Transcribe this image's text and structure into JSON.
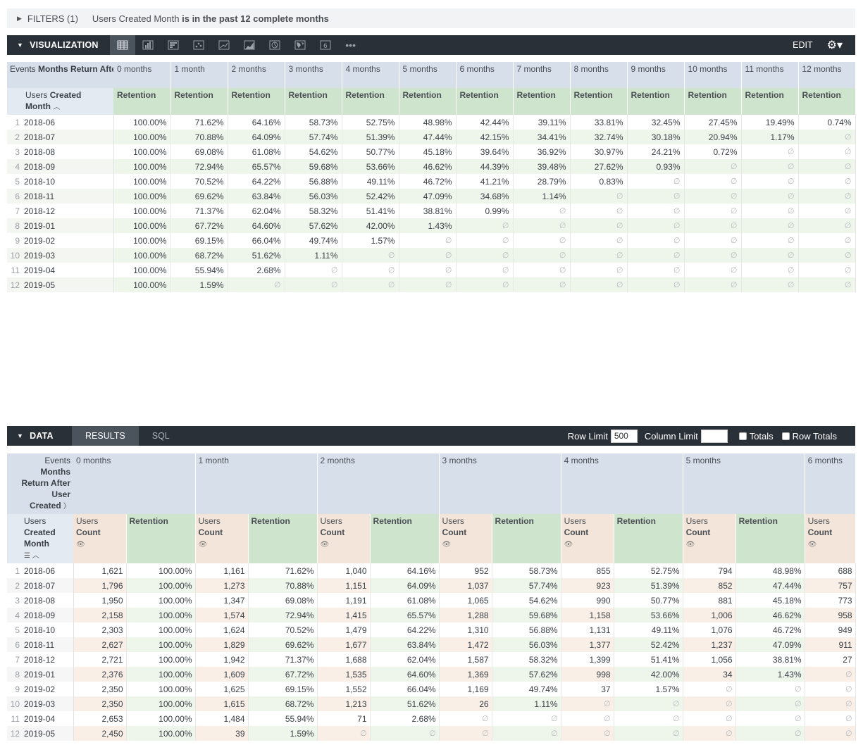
{
  "filters": {
    "label": "FILTERS (1)",
    "field": "Users Created Month",
    "condition": "is in the past 12 complete months"
  },
  "visualization": {
    "title": "VISUALIZATION",
    "edit_label": "EDIT",
    "icons": [
      "table-icon",
      "bar-chart-icon",
      "column-chart-icon",
      "scatter-icon",
      "line-icon",
      "area-icon",
      "pie-icon",
      "map-icon",
      "single-value-icon",
      "more-icon"
    ]
  },
  "viz_table": {
    "pivot_label_1": "Events",
    "pivot_label_bold": "Months Return After User Created",
    "dim_label_1": "Users",
    "dim_label_bold": "Created",
    "dim_label_2": "Month",
    "measure": "Retention",
    "columns": [
      "0 months",
      "1 month",
      "2 months",
      "3 months",
      "4 months",
      "5 months",
      "6 months",
      "7 months",
      "8 months",
      "9 months",
      "10 months",
      "11 months",
      "12 months"
    ],
    "rows": [
      {
        "n": "1",
        "month": "2018-06",
        "v": [
          "100.00%",
          "71.62%",
          "64.16%",
          "58.73%",
          "52.75%",
          "48.98%",
          "42.44%",
          "39.11%",
          "33.81%",
          "32.45%",
          "27.45%",
          "19.49%",
          "0.74%"
        ]
      },
      {
        "n": "2",
        "month": "2018-07",
        "v": [
          "100.00%",
          "70.88%",
          "64.09%",
          "57.74%",
          "51.39%",
          "47.44%",
          "42.15%",
          "34.41%",
          "32.74%",
          "30.18%",
          "20.94%",
          "1.17%",
          "∅"
        ]
      },
      {
        "n": "3",
        "month": "2018-08",
        "v": [
          "100.00%",
          "69.08%",
          "61.08%",
          "54.62%",
          "50.77%",
          "45.18%",
          "39.64%",
          "36.92%",
          "30.97%",
          "24.21%",
          "0.72%",
          "∅",
          "∅"
        ]
      },
      {
        "n": "4",
        "month": "2018-09",
        "v": [
          "100.00%",
          "72.94%",
          "65.57%",
          "59.68%",
          "53.66%",
          "46.62%",
          "44.39%",
          "39.48%",
          "27.62%",
          "0.93%",
          "∅",
          "∅",
          "∅"
        ]
      },
      {
        "n": "5",
        "month": "2018-10",
        "v": [
          "100.00%",
          "70.52%",
          "64.22%",
          "56.88%",
          "49.11%",
          "46.72%",
          "41.21%",
          "28.79%",
          "0.83%",
          "∅",
          "∅",
          "∅",
          "∅"
        ]
      },
      {
        "n": "6",
        "month": "2018-11",
        "v": [
          "100.00%",
          "69.62%",
          "63.84%",
          "56.03%",
          "52.42%",
          "47.09%",
          "34.68%",
          "1.14%",
          "∅",
          "∅",
          "∅",
          "∅",
          "∅"
        ]
      },
      {
        "n": "7",
        "month": "2018-12",
        "v": [
          "100.00%",
          "71.37%",
          "62.04%",
          "58.32%",
          "51.41%",
          "38.81%",
          "0.99%",
          "∅",
          "∅",
          "∅",
          "∅",
          "∅",
          "∅"
        ]
      },
      {
        "n": "8",
        "month": "2019-01",
        "v": [
          "100.00%",
          "67.72%",
          "64.60%",
          "57.62%",
          "42.00%",
          "1.43%",
          "∅",
          "∅",
          "∅",
          "∅",
          "∅",
          "∅",
          "∅"
        ]
      },
      {
        "n": "9",
        "month": "2019-02",
        "v": [
          "100.00%",
          "69.15%",
          "66.04%",
          "49.74%",
          "1.57%",
          "∅",
          "∅",
          "∅",
          "∅",
          "∅",
          "∅",
          "∅",
          "∅"
        ]
      },
      {
        "n": "10",
        "month": "2019-03",
        "v": [
          "100.00%",
          "68.72%",
          "51.62%",
          "1.11%",
          "∅",
          "∅",
          "∅",
          "∅",
          "∅",
          "∅",
          "∅",
          "∅",
          "∅"
        ]
      },
      {
        "n": "11",
        "month": "2019-04",
        "v": [
          "100.00%",
          "55.94%",
          "2.68%",
          "∅",
          "∅",
          "∅",
          "∅",
          "∅",
          "∅",
          "∅",
          "∅",
          "∅",
          "∅"
        ]
      },
      {
        "n": "12",
        "month": "2019-05",
        "v": [
          "100.00%",
          "1.59%",
          "∅",
          "∅",
          "∅",
          "∅",
          "∅",
          "∅",
          "∅",
          "∅",
          "∅",
          "∅",
          "∅"
        ]
      }
    ]
  },
  "data": {
    "title": "DATA",
    "tab_results": "RESULTS",
    "tab_sql": "SQL",
    "row_limit_label": "Row Limit",
    "row_limit_value": "500",
    "column_limit_label": "Column Limit",
    "column_limit_value": "",
    "totals_label": "Totals",
    "row_totals_label": "Row Totals"
  },
  "data_table": {
    "pivot_l1": "Events",
    "pivot_l2": "Months",
    "pivot_l3": "Return After",
    "pivot_l4": "User",
    "pivot_l5": "Created",
    "dim_l1": "Users",
    "dim_l2": "Created",
    "dim_l3": "Month",
    "count_l1": "Users",
    "count_l2": "Count",
    "retention": "Retention",
    "columns": [
      "0 months",
      "1 month",
      "2 months",
      "3 months",
      "4 months",
      "5 months",
      "6 months"
    ],
    "rows": [
      {
        "n": "1",
        "month": "2018-06",
        "v": [
          "1,621",
          "100.00%",
          "1,161",
          "71.62%",
          "1,040",
          "64.16%",
          "952",
          "58.73%",
          "855",
          "52.75%",
          "794",
          "48.98%",
          "688"
        ]
      },
      {
        "n": "2",
        "month": "2018-07",
        "v": [
          "1,796",
          "100.00%",
          "1,273",
          "70.88%",
          "1,151",
          "64.09%",
          "1,037",
          "57.74%",
          "923",
          "51.39%",
          "852",
          "47.44%",
          "757"
        ]
      },
      {
        "n": "3",
        "month": "2018-08",
        "v": [
          "1,950",
          "100.00%",
          "1,347",
          "69.08%",
          "1,191",
          "61.08%",
          "1,065",
          "54.62%",
          "990",
          "50.77%",
          "881",
          "45.18%",
          "773"
        ]
      },
      {
        "n": "4",
        "month": "2018-09",
        "v": [
          "2,158",
          "100.00%",
          "1,574",
          "72.94%",
          "1,415",
          "65.57%",
          "1,288",
          "59.68%",
          "1,158",
          "53.66%",
          "1,006",
          "46.62%",
          "958"
        ]
      },
      {
        "n": "5",
        "month": "2018-10",
        "v": [
          "2,303",
          "100.00%",
          "1,624",
          "70.52%",
          "1,479",
          "64.22%",
          "1,310",
          "56.88%",
          "1,131",
          "49.11%",
          "1,076",
          "46.72%",
          "949"
        ]
      },
      {
        "n": "6",
        "month": "2018-11",
        "v": [
          "2,627",
          "100.00%",
          "1,829",
          "69.62%",
          "1,677",
          "63.84%",
          "1,472",
          "56.03%",
          "1,377",
          "52.42%",
          "1,237",
          "47.09%",
          "911"
        ]
      },
      {
        "n": "7",
        "month": "2018-12",
        "v": [
          "2,721",
          "100.00%",
          "1,942",
          "71.37%",
          "1,688",
          "62.04%",
          "1,587",
          "58.32%",
          "1,399",
          "51.41%",
          "1,056",
          "38.81%",
          "27"
        ]
      },
      {
        "n": "8",
        "month": "2019-01",
        "v": [
          "2,376",
          "100.00%",
          "1,609",
          "67.72%",
          "1,535",
          "64.60%",
          "1,369",
          "57.62%",
          "998",
          "42.00%",
          "34",
          "1.43%",
          "∅"
        ]
      },
      {
        "n": "9",
        "month": "2019-02",
        "v": [
          "2,350",
          "100.00%",
          "1,625",
          "69.15%",
          "1,552",
          "66.04%",
          "1,169",
          "49.74%",
          "37",
          "1.57%",
          "∅",
          "∅",
          "∅"
        ]
      },
      {
        "n": "10",
        "month": "2019-03",
        "v": [
          "2,350",
          "100.00%",
          "1,615",
          "68.72%",
          "1,213",
          "51.62%",
          "26",
          "1.11%",
          "∅",
          "∅",
          "∅",
          "∅",
          "∅"
        ]
      },
      {
        "n": "11",
        "month": "2019-04",
        "v": [
          "2,653",
          "100.00%",
          "1,484",
          "55.94%",
          "71",
          "2.68%",
          "∅",
          "∅",
          "∅",
          "∅",
          "∅",
          "∅",
          "∅"
        ]
      },
      {
        "n": "12",
        "month": "2019-05",
        "v": [
          "2,450",
          "100.00%",
          "39",
          "1.59%",
          "∅",
          "∅",
          "∅",
          "∅",
          "∅",
          "∅",
          "∅",
          "∅",
          "∅"
        ]
      }
    ]
  }
}
